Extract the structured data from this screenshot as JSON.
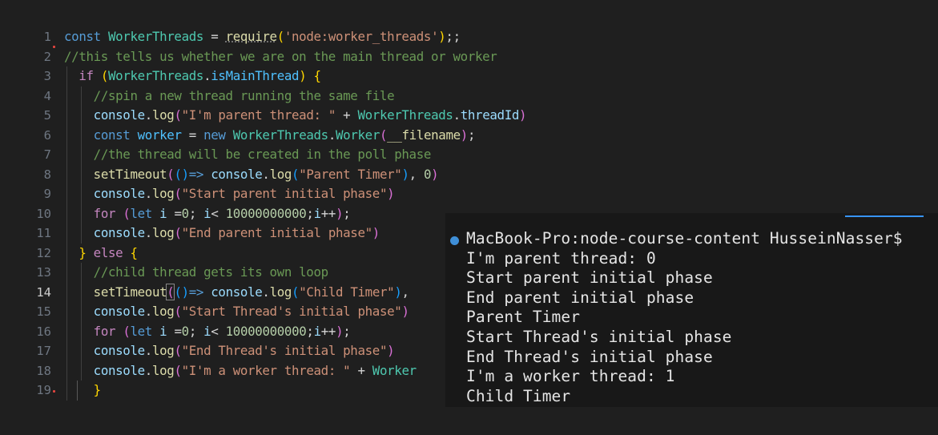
{
  "editor": {
    "lines": [
      {
        "num": "1",
        "html": "<span class=\"kw\">const</span> <span class=\"cls\">WorkerThreads</span> = <span class=\"fn\" style=\"text-decoration:underline dotted #888\">require</span><span class=\"p1\">(</span><span class=\"str\">'node:worker_threads'</span><span class=\"p1\">)</span>;;"
      },
      {
        "num": "2",
        "html": "<span class=\"cmt\">//this tells us whether we are on the main thread or worker</span>"
      },
      {
        "num": "3",
        "html": "  <span class=\"ctl\">if</span> <span class=\"p1\">(</span><span class=\"cls\">WorkerThreads</span>.<span class=\"var\">isMainThread</span><span class=\"p1\">)</span> <span class=\"p1\">{</span>"
      },
      {
        "num": "4",
        "html": "    <span class=\"cmt\">//spin a new thread running the same file</span>"
      },
      {
        "num": "5",
        "html": "    <span class=\"vr\">console</span>.<span class=\"fn\">log</span><span class=\"p2\">(</span><span class=\"str\">\"I'm parent thread: \"</span> + <span class=\"cls\">WorkerThreads</span>.<span class=\"prop\">threadId</span><span class=\"p2\">)</span>"
      },
      {
        "num": "6",
        "html": "    <span class=\"kw\">const</span> <span class=\"var\">worker</span> = <span class=\"kw\">new</span> <span class=\"cls\">WorkerThreads</span>.<span class=\"cls\">Worker</span><span class=\"p2\">(</span><span class=\"glob\">__filename</span><span class=\"p2\">)</span>;"
      },
      {
        "num": "7",
        "html": "    <span class=\"cmt\">//the thread will be created in the poll phase</span>"
      },
      {
        "num": "8",
        "html": "    <span class=\"fn\">setTimeout</span><span class=\"p2\">(</span><span class=\"p3\">()</span><span class=\"kw\">=></span> <span class=\"vr\">console</span>.<span class=\"fn\">log</span><span class=\"p3\">(</span><span class=\"str\">\"Parent Timer\"</span><span class=\"p3\">)</span>, <span class=\"num\">0</span><span class=\"p2\">)</span>"
      },
      {
        "num": "9",
        "html": "    <span class=\"vr\">console</span>.<span class=\"fn\">log</span><span class=\"p2\">(</span><span class=\"str\">\"Start parent initial phase\"</span><span class=\"p2\">)</span>"
      },
      {
        "num": "10",
        "html": "    <span class=\"ctl\">for</span> <span class=\"p2\">(</span><span class=\"kw\">let</span> <span class=\"vr\">i</span> =<span class=\"num\">0</span>; <span class=\"vr\">i</span>&lt; <span class=\"num\">10000000000</span>;<span class=\"vr\">i</span>++<span class=\"p2\">)</span>;"
      },
      {
        "num": "11",
        "html": "    <span class=\"vr\">console</span>.<span class=\"fn\">log</span><span class=\"p2\">(</span><span class=\"str\">\"End parent initial phase\"</span><span class=\"p2\">)</span>"
      },
      {
        "num": "12",
        "html": "  <span class=\"p1\">}</span> <span class=\"ctl\">else</span> <span class=\"p1\">{</span>"
      },
      {
        "num": "13",
        "html": "    <span class=\"cmt\">//child thread gets its own loop</span>"
      },
      {
        "num": "14",
        "html": "    <span class=\"fn\">setTimeout</span><span class=\"p2\" style=\"outline:1px solid #888\">(</span><span class=\"p3\">()</span><span class=\"kw\">=></span> <span class=\"vr\">console</span>.<span class=\"fn\">log</span><span class=\"p3\">(</span><span class=\"str\">\"Child Timer\"</span><span class=\"p3\">)</span>,"
      },
      {
        "num": "15",
        "html": "    <span class=\"vr\">console</span>.<span class=\"fn\">log</span><span class=\"p2\">(</span><span class=\"str\">\"Start Thread's initial phase\"</span><span class=\"p2\">)</span>"
      },
      {
        "num": "16",
        "html": "    <span class=\"ctl\">for</span> <span class=\"p2\">(</span><span class=\"kw\">let</span> <span class=\"vr\">i</span> =<span class=\"num\">0</span>; <span class=\"vr\">i</span>&lt; <span class=\"num\">10000000000</span>;<span class=\"vr\">i</span>++<span class=\"p2\">)</span>;"
      },
      {
        "num": "17",
        "html": "    <span class=\"vr\">console</span>.<span class=\"fn\">log</span><span class=\"p2\">(</span><span class=\"str\">\"End Thread's initial phase\"</span><span class=\"p2\">)</span>"
      },
      {
        "num": "18",
        "html": "    <span class=\"vr\">console</span>.<span class=\"fn\">log</span><span class=\"p2\">(</span><span class=\"str\">\"I'm a worker thread: \"</span> + <span class=\"cls\">Worker</span>"
      },
      {
        "num": "19",
        "html": "    <span class=\"p1\">}</span>"
      }
    ],
    "active_line": "14"
  },
  "terminal": {
    "prompt": "MacBook-Pro:node-course-content HusseinNasser$",
    "output": [
      "I'm parent thread: 0",
      "Start parent initial phase",
      "End parent initial phase",
      "Parent Timer",
      "Start Thread's initial phase",
      "End Thread's initial phase",
      "I'm a worker thread: 1",
      "Child Timer"
    ]
  },
  "colors": {
    "editor_bg": "#1f1f1f",
    "terminal_bg": "#181818",
    "prompt_dot": "#3f8fd8",
    "accent": "#3794ff"
  }
}
